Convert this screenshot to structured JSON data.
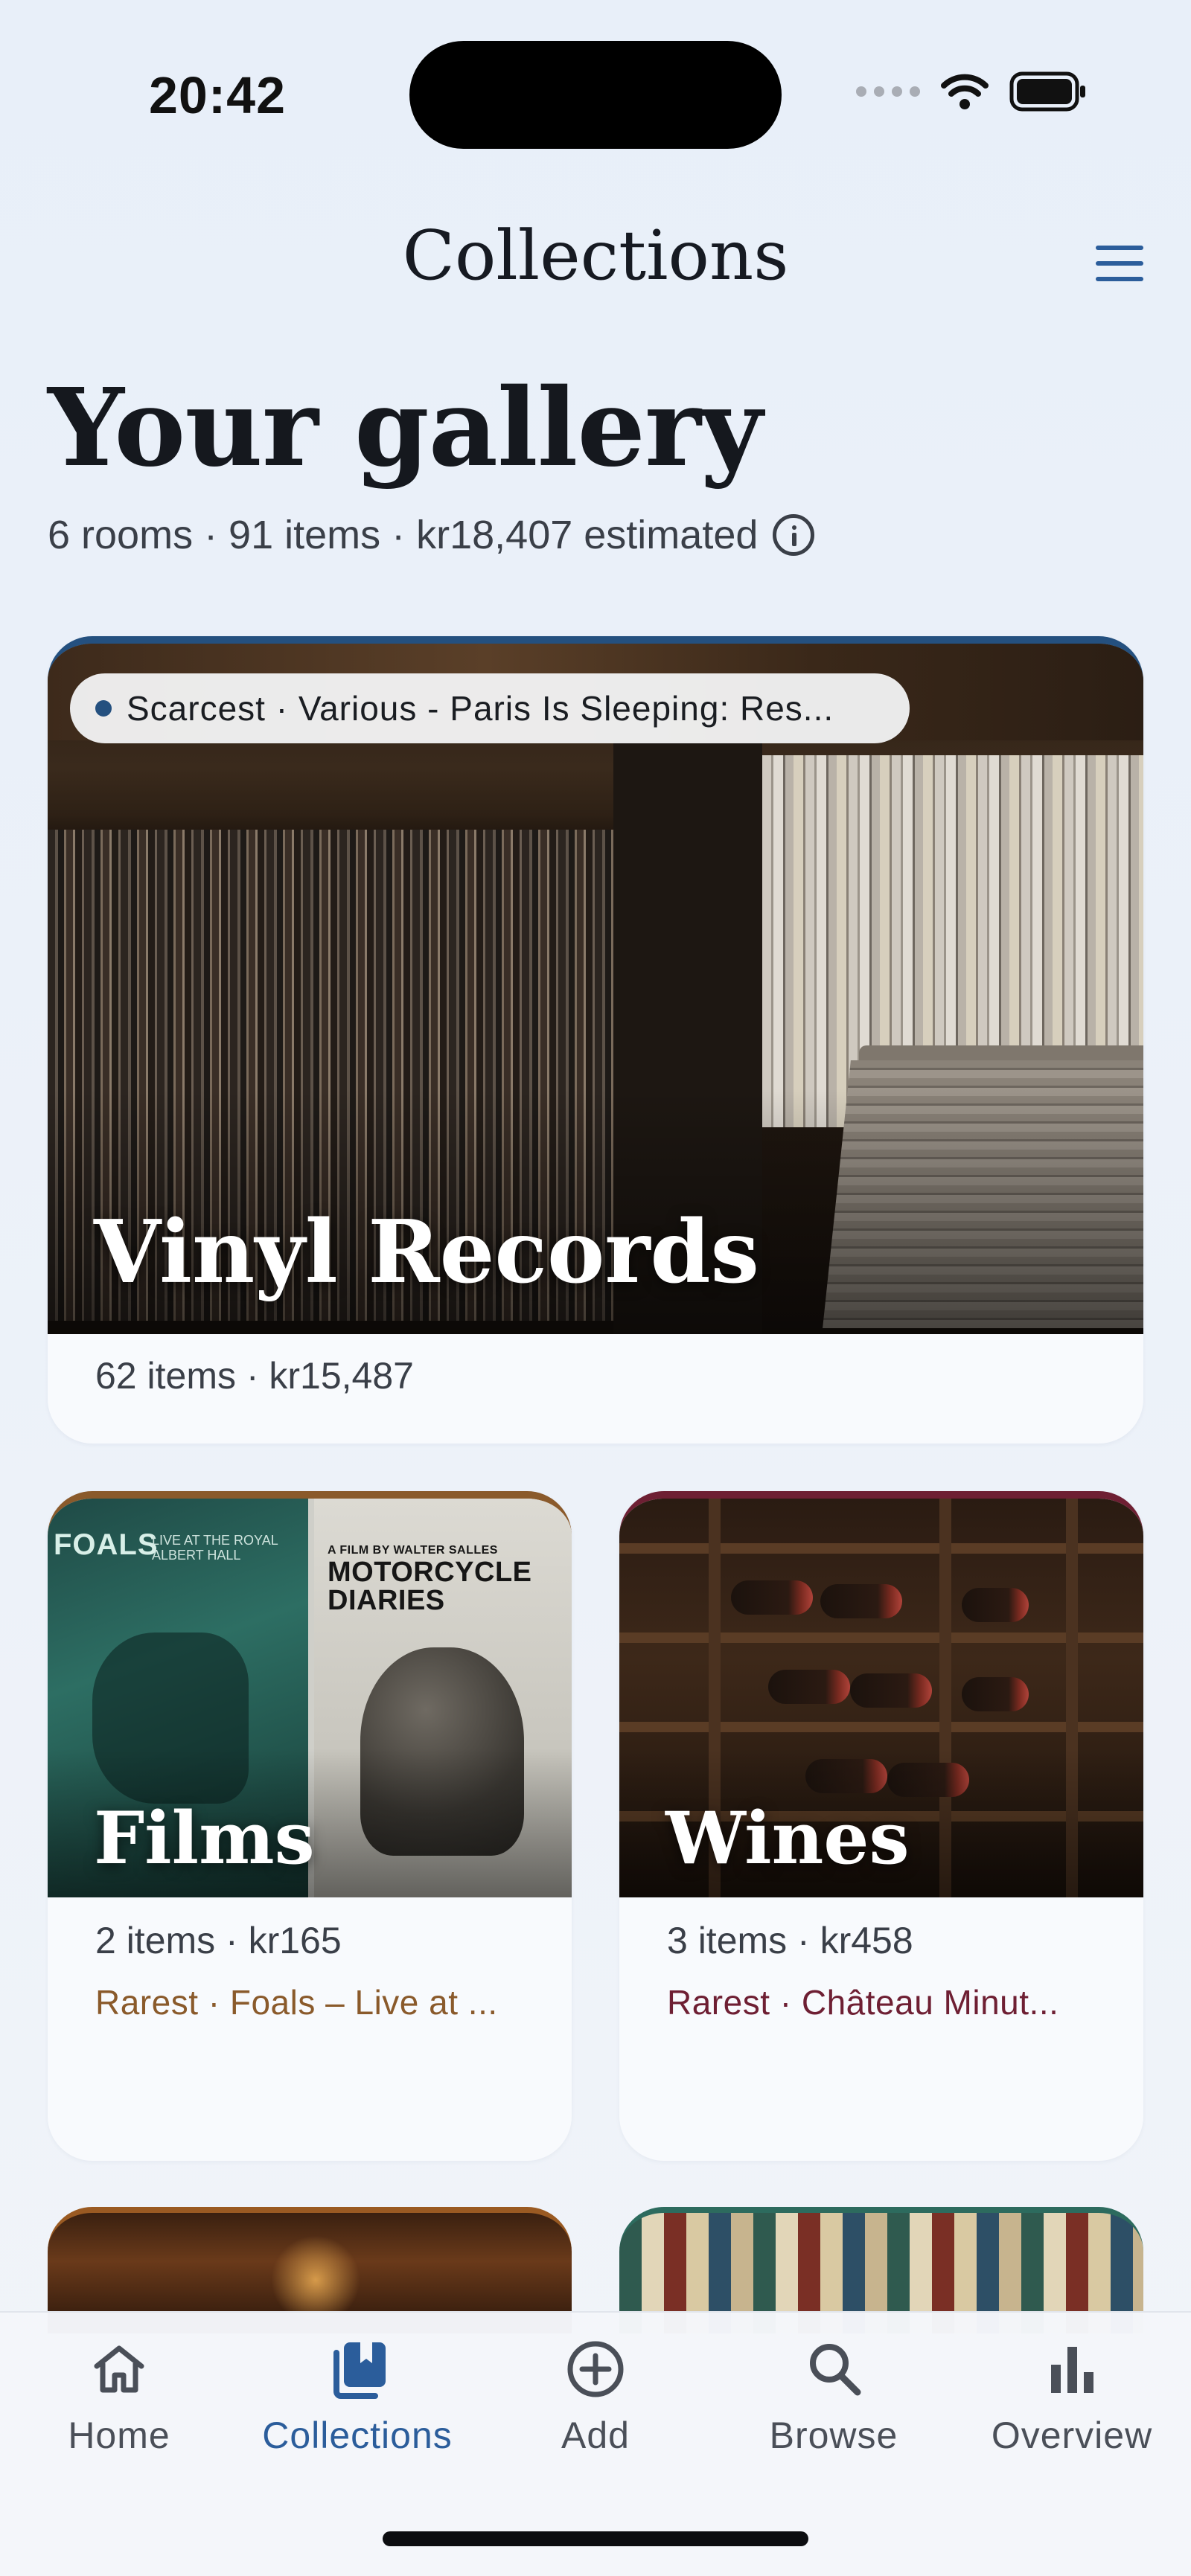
{
  "status_bar": {
    "time": "20:42"
  },
  "header": {
    "title": "Collections"
  },
  "gallery": {
    "title": "Your gallery",
    "summary": "6 rooms · 91 items · kr18,407 estimated"
  },
  "collections": [
    {
      "name": "Vinyl Records",
      "meta": "62 items · kr15,487",
      "badge": "Scarcest · Various - Paris Is Sleeping: Res...",
      "accent": "#24507f"
    },
    {
      "name": "Films",
      "meta": "2 items · kr165",
      "rarest": "Rarest · Foals – Live at ...",
      "accent": "#8a5a2b",
      "artwork": {
        "left_title": "FOALS",
        "left_sub": "LIVE AT THE ROYAL ALBERT HALL",
        "right_tagline": "A FILM BY WALTER SALLES",
        "right_title": "MOTORCYCLE DIARIES"
      }
    },
    {
      "name": "Wines",
      "meta": "3 items · kr458",
      "rarest": "Rarest · Château Minut...",
      "accent": "#6e1f33"
    }
  ],
  "tabs": [
    {
      "label": "Home",
      "icon": "home-icon"
    },
    {
      "label": "Collections",
      "icon": "collections-icon",
      "active": true
    },
    {
      "label": "Add",
      "icon": "add-circle-icon"
    },
    {
      "label": "Browse",
      "icon": "search-icon"
    },
    {
      "label": "Overview",
      "icon": "bar-chart-icon"
    }
  ],
  "colors": {
    "accent": "#2b5d9b",
    "background": "#e8eff9",
    "card": "#f8fafd"
  }
}
